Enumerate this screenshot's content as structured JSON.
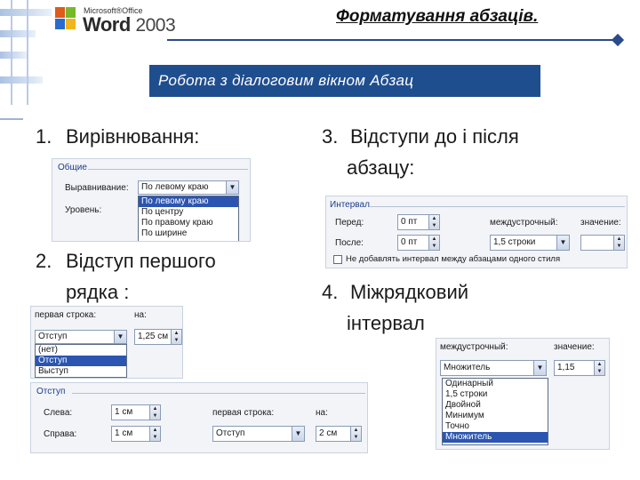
{
  "header": {
    "brand_top": "Microsoft®Office",
    "brand_word": "Word",
    "brand_year": "2003",
    "page_title": "Форматування абзаців.",
    "banner": "Робота з діалоговим вікном Абзац"
  },
  "sections": {
    "s1_num": "1.",
    "s1_text": "Вирівнювання:",
    "s2_num": "2.",
    "s2_line1": "Відступ першого",
    "s2_line2": "рядка :",
    "s3_num": "3.",
    "s3_line1": "Відступи до і після",
    "s3_line2": "абзацу:",
    "s4_num": "4.",
    "s4_line1": "Міжрядковий",
    "s4_line2": "інтервал"
  },
  "align_dialog": {
    "group": "Общие",
    "align_label": "Выравнивание:",
    "align_value": "По левому краю",
    "level_label": "Уровень:",
    "options": [
      "По левому краю",
      "По центру",
      "По правому краю",
      "По ширине"
    ],
    "selected_index": 0
  },
  "first_line_dialog": {
    "first_line_label": "первая строка:",
    "by_label": "на:",
    "value": "Отступ",
    "by_value": "1,25 см",
    "options": [
      "(нет)",
      "Отступ",
      "Выступ"
    ],
    "selected_index": 1
  },
  "indent_dialog": {
    "group": "Отступ",
    "left_label": "Слева:",
    "left_value": "1 см",
    "right_label": "Справа:",
    "right_value": "1 см",
    "first_line_label": "первая строка:",
    "first_line_value": "Отступ",
    "by_label": "на:",
    "by_value": "2 см"
  },
  "spacing_dialog": {
    "group": "Интервал",
    "before_label": "Перед:",
    "before_value": "0 пт",
    "after_label": "После:",
    "after_value": "0 пт",
    "line_label": "междустрочный:",
    "line_value": "1,5 строки",
    "value_label": "значение:",
    "value_value": "",
    "checkbox_label": "Не добавлять интервал между абзацами одного стиля",
    "checkbox_checked": false
  },
  "line_spacing_dialog": {
    "line_label": "междустрочный:",
    "value_label": "значение:",
    "line_value": "Множитель",
    "value_value": "1,15",
    "options": [
      "Одинарный",
      "1,5 строки",
      "Двойной",
      "Минимум",
      "Точно",
      "Множитель"
    ],
    "selected_index": 5
  },
  "colors": {
    "banner_bg": "#1f4e8f",
    "selection": "#2b55b0",
    "rule": "#2a4a8a"
  }
}
